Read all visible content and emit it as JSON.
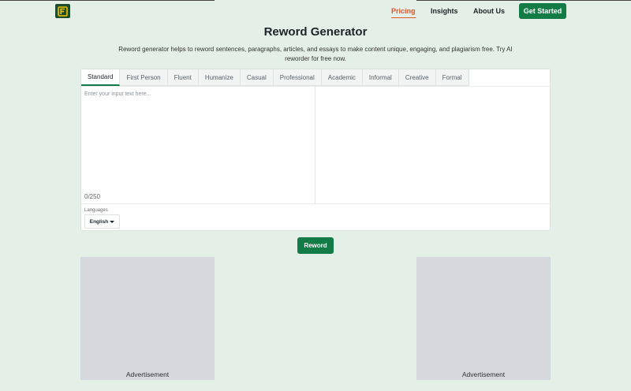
{
  "nav": {
    "links": [
      "Pricing",
      "Insights",
      "About Us"
    ],
    "cta": "Get Started"
  },
  "page": {
    "title": "Reword Generator",
    "subtitle": "Reword generator helps to reword sentences, paragraphs, articles, and essays to make content unique, engaging, and plagiarism free. Try AI reworder for free now."
  },
  "tabs": [
    "Standard",
    "First Person",
    "Fluent",
    "Humanize",
    "Casual",
    "Professional",
    "Academic",
    "Informal",
    "Creative",
    "Formal"
  ],
  "editor": {
    "placeholder": "Enter your input text here...",
    "counter": "0/250",
    "languages_label": "Languages",
    "language_value": "English"
  },
  "reword_button": "Reword",
  "ads": {
    "left_label": "Advertisement",
    "right_label": "Advertisement"
  },
  "colors": {
    "accent": "#137b45",
    "active_link": "#e0562b",
    "background": "#e4efe7"
  }
}
